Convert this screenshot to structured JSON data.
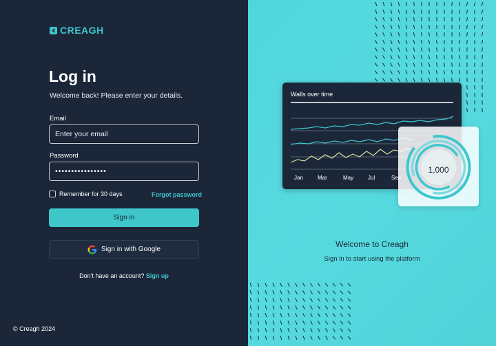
{
  "brand": {
    "name": "CREAGH",
    "accent": "#3ec6cf",
    "panel_bg": "#1b2739",
    "hero_bg": "#52d8dd"
  },
  "login": {
    "title": "Log in",
    "subtitle": "Welcome back! Please enter your details.",
    "email_label": "Email",
    "email_placeholder": "Enter your email",
    "password_label": "Password",
    "password_value": "••••••••••••••••",
    "remember_label": "Remember for 30 days",
    "forgot_label": "Forgot password",
    "signin_label": "Sign in",
    "google_label": "Sign in with Google",
    "signup_prompt": "Don't have an account?",
    "signup_link": "Sign up"
  },
  "footer": {
    "copyright": "© Creagh 2024"
  },
  "hero": {
    "chart_title": "Walls over time",
    "months": [
      "Jan",
      "Mar",
      "May",
      "Jul",
      "Sep"
    ],
    "stat_value": "1,000",
    "welcome_title": "Welcome to Creagh",
    "welcome_sub": "Sign in to start using the platform"
  },
  "icons": {
    "logo": "creagh-logo-icon",
    "google": "google-icon"
  }
}
